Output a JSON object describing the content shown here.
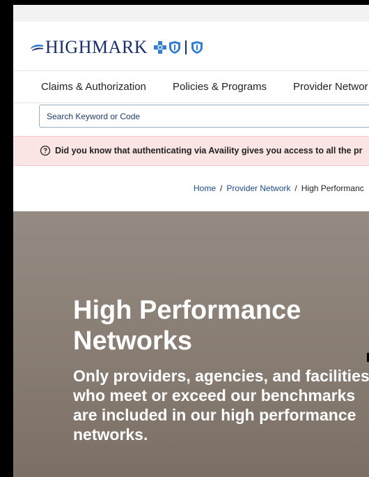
{
  "brand": {
    "name": "HIGHMARK"
  },
  "nav": {
    "items": [
      {
        "label": "Claims & Authorization"
      },
      {
        "label": "Policies & Programs"
      },
      {
        "label": "Provider Networ"
      }
    ]
  },
  "search": {
    "placeholder": "Search Keyword or Code"
  },
  "banner": {
    "text": "Did you know that authenticating via Availity gives you access to all the pr"
  },
  "breadcrumb": {
    "home": "Home",
    "sep": "/",
    "network": "Provider Network",
    "current": "High Performanc"
  },
  "hero": {
    "title": "High Performance Networks",
    "subtitle": "Only providers, agencies, and facilities who meet or exceed our benchmarks are included in our high performance networks."
  },
  "colors": {
    "brand_navy": "#1a2e6b",
    "brand_blue": "#2f7fd0",
    "banner_bg": "#fbe4e4",
    "hero_bg": "#8d8278"
  }
}
